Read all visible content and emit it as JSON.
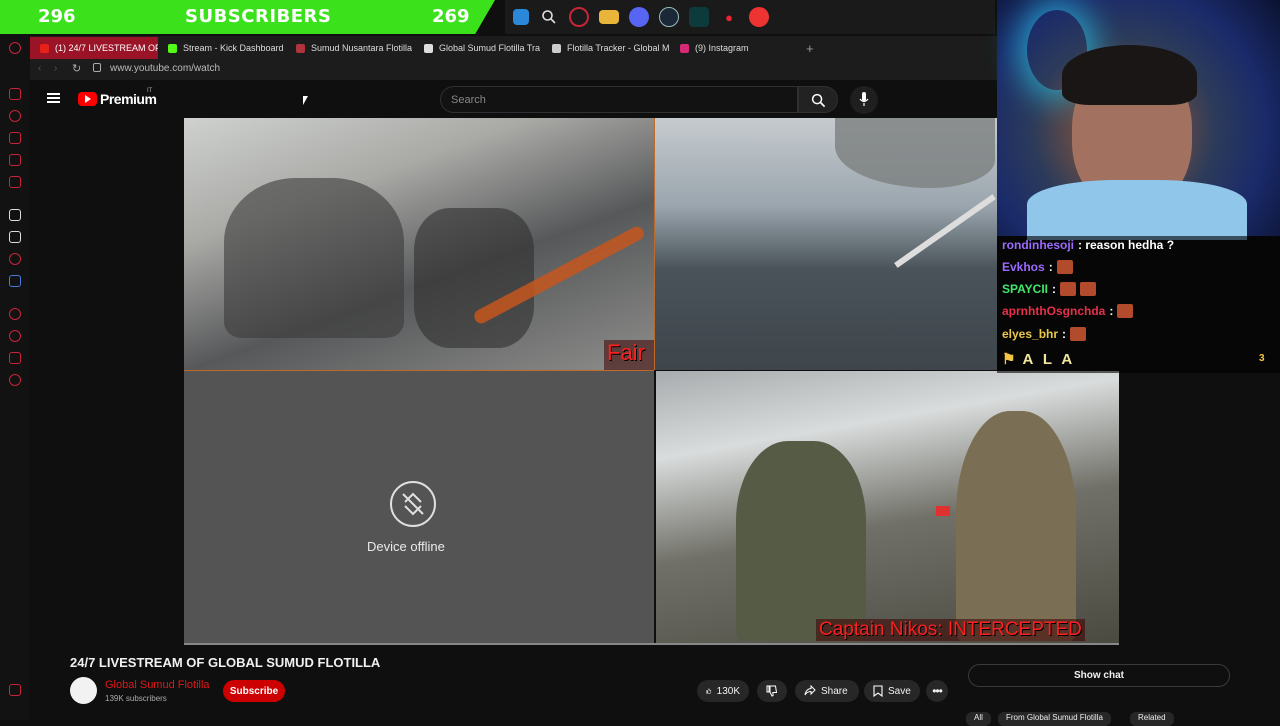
{
  "overlay": {
    "sub_count_left": "296",
    "sub_label": "SUBSCRIBERS",
    "sub_count_right": "269"
  },
  "browser": {
    "tabs": [
      {
        "label": "(1) 24/7 LIVESTREAM OF",
        "icon_color": "#e62117",
        "active": true
      },
      {
        "label": "Stream - Kick Dashboard",
        "icon_color": "#53fc18",
        "active": false
      },
      {
        "label": "Sumud Nusantara Flotilla",
        "icon_color": "#b0343c",
        "active": false
      },
      {
        "label": "Global Sumud Flotilla Tra",
        "icon_color": "#dddddd",
        "active": false
      },
      {
        "label": "Flotilla Tracker - Global M",
        "icon_color": "#cccccc",
        "active": false
      },
      {
        "label": "(9) Instagram",
        "icon_color": "#d62976",
        "active": false
      }
    ],
    "url": "www.youtube.com/watch"
  },
  "youtube": {
    "logo_text": "Premium",
    "logo_superscript": "IT",
    "search_placeholder": "Search",
    "video_title": "24/7 LIVESTREAM OF GLOBAL SUMUD FLOTILLA",
    "channel_name": "Global Sumud Flotilla",
    "subscribers": "139K subscribers",
    "subscribe_label": "Subscribe",
    "likes": "130K",
    "share_label": "Share",
    "save_label": "Save",
    "show_chat_label": "Show chat",
    "chips": [
      "All",
      "From Global Sumud Flotilla",
      "Related"
    ]
  },
  "video": {
    "pane1_label": "Fair Lady",
    "pane3_status": "Device offline",
    "pane4_label": "Captain Nikos: INTERCEPTED"
  },
  "chat": {
    "messages": [
      {
        "user": "rondinhesoji",
        "user_color": "#9b6bff",
        "text": ": reason hedha ?",
        "emotes": 0
      },
      {
        "user": "Evkhos",
        "user_color": "#9b6bff",
        "text": ":",
        "emotes": 1
      },
      {
        "user": "SPAYCII",
        "user_color": "#3fe86b",
        "text": ":",
        "emotes": 2
      },
      {
        "user": "aprnhthOsgnchda",
        "user_color": "#e8304a",
        "text": ":",
        "emotes": 1
      },
      {
        "user": "elyes_bhr",
        "user_color": "#e8c74a",
        "text": ":",
        "emotes": 1
      }
    ],
    "badge_name": "A L A",
    "badge_count": "3"
  }
}
